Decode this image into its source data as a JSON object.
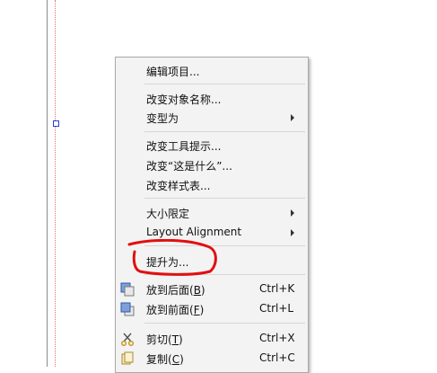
{
  "menu": {
    "edit_items": "编辑项目...",
    "rename_object": "改变对象名称...",
    "morph_into": "变型为",
    "change_tooltip": "改变工具提示...",
    "change_whats_this": "改变“这是什么”...",
    "change_stylesheet": "改变样式表...",
    "size_constraints": "大小限定",
    "layout_alignment": "Layout Alignment",
    "promote_to": "提升为...",
    "send_to_back": {
      "label_pre": "放到后面(",
      "mnemonic": "B",
      "label_post": ")",
      "shortcut": "Ctrl+K"
    },
    "bring_to_front": {
      "label_pre": "放到前面(",
      "mnemonic": "F",
      "label_post": ")",
      "shortcut": "Ctrl+L"
    },
    "cut": {
      "label_pre": "剪切(",
      "mnemonic": "T",
      "label_post": ")",
      "shortcut": "Ctrl+X"
    },
    "copy": {
      "label_pre": "复制(",
      "mnemonic": "C",
      "label_post": ")",
      "shortcut": "Ctrl+C"
    }
  },
  "icons": {
    "send_to_back": "send-to-back-icon",
    "bring_to_front": "bring-to-front-icon",
    "cut": "scissors-icon",
    "copy": "copy-icon"
  },
  "colors": {
    "menu_bg": "#f3f3f3",
    "highlight_stroke": "#e01010",
    "selection_handle": "#2d3fd0"
  }
}
